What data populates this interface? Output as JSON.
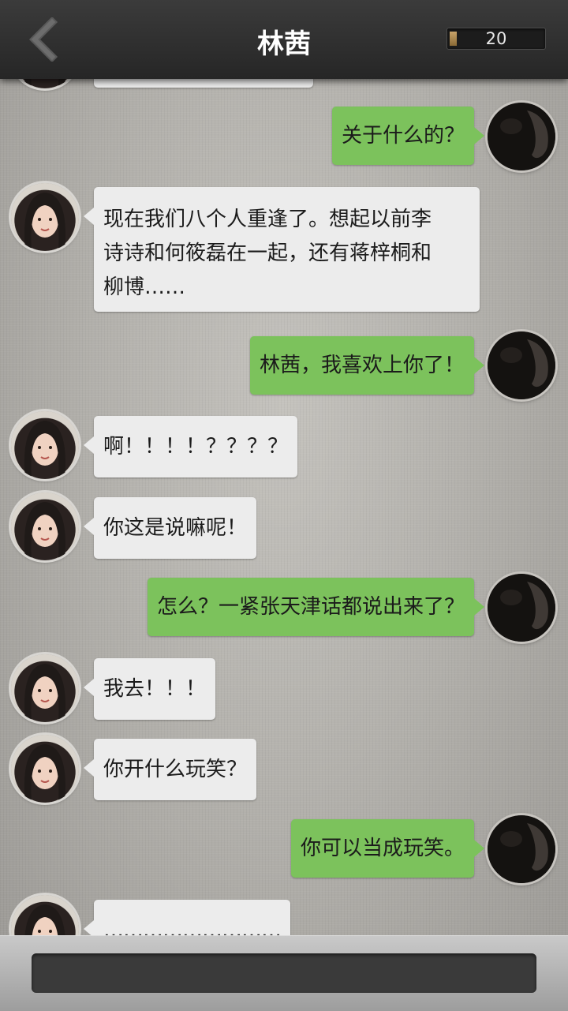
{
  "header": {
    "title": "林茜",
    "counter_value": "20",
    "counter_fill": 0.08
  },
  "messages": [
    {
      "side": "left",
      "text": ""
    },
    {
      "side": "right",
      "text": "关于什么的？"
    },
    {
      "side": "left",
      "text": "现在我们八个人重逢了。想起以前李\n诗诗和何筱磊在一起，还有蒋梓桐和\n柳博……"
    },
    {
      "side": "right",
      "text": "林茜，我喜欢上你了！"
    },
    {
      "side": "left",
      "text": "啊！！！！？？？？"
    },
    {
      "side": "left",
      "text": "你这是说嘛呢！"
    },
    {
      "side": "right",
      "text": "怎么？一紧张天津话都说出来了？"
    },
    {
      "side": "left",
      "text": "我去！！！"
    },
    {
      "side": "left",
      "text": "你开什么玩笑？"
    },
    {
      "side": "right",
      "text": "你可以当成玩笑。"
    },
    {
      "side": "left",
      "text": "………………………"
    }
  ],
  "colors": {
    "header": "#2e2e2e",
    "outgoing_bubble": "#7cc25c",
    "incoming_bubble": "#ececec"
  },
  "icons": {
    "back": "chevron-left-icon",
    "counter": "progress-bar"
  }
}
